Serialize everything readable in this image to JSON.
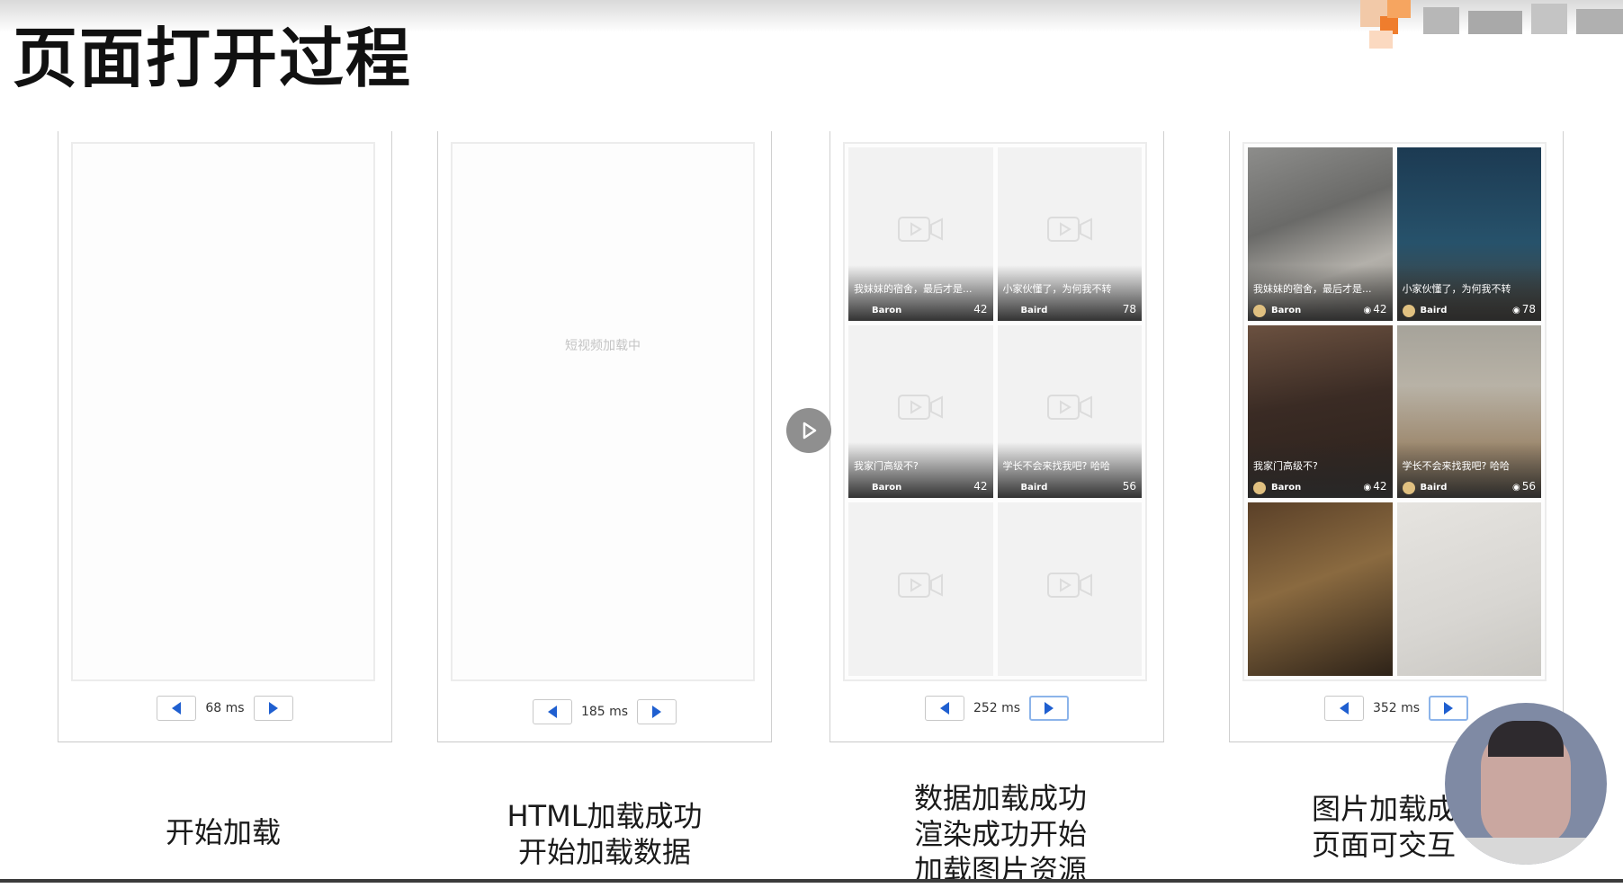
{
  "slide": {
    "title": "页面打开过程"
  },
  "panels": [
    {
      "timing": "68 ms",
      "caption": [
        "开始加载"
      ],
      "state": "blank"
    },
    {
      "timing": "185 ms",
      "caption": [
        "HTML加载成功",
        "开始加载数据"
      ],
      "state": "loading",
      "loading_text": "短视频加载中"
    },
    {
      "timing": "252 ms",
      "caption": [
        "数据加载成功",
        "渲染成功开始",
        "加载图片资源"
      ],
      "state": "placeholders",
      "items": [
        {
          "caption": "我妹妹的宿舍，最后才是...",
          "author": "Baron",
          "count": "42"
        },
        {
          "caption": "小家伙懂了，为何我不转",
          "author": "Baird",
          "count": "78"
        },
        {
          "caption": "我家门高级不?",
          "author": "Baron",
          "count": "42"
        },
        {
          "caption": "学长不会来找我吧? 哈哈",
          "author": "Baird",
          "count": "56"
        },
        {
          "caption": "",
          "author": "",
          "count": ""
        },
        {
          "caption": "",
          "author": "",
          "count": ""
        }
      ]
    },
    {
      "timing": "352 ms",
      "caption": [
        "图片加载成",
        "页面可交互"
      ],
      "state": "images",
      "items": [
        {
          "caption": "我妹妹的宿舍，最后才是...",
          "author": "Baron",
          "count": "42"
        },
        {
          "caption": "小家伙懂了，为何我不转",
          "author": "Baird",
          "count": "78"
        },
        {
          "caption": "我家门高级不?",
          "author": "Baron",
          "count": "42"
        },
        {
          "caption": "学长不会来找我吧? 哈哈",
          "author": "Baird",
          "count": "56"
        },
        {
          "caption": "",
          "author": "",
          "count": ""
        },
        {
          "caption": "",
          "author": "",
          "count": ""
        }
      ]
    }
  ],
  "colors": {
    "accent": "#1f5fd0",
    "active_border": "#8cb4ea"
  }
}
